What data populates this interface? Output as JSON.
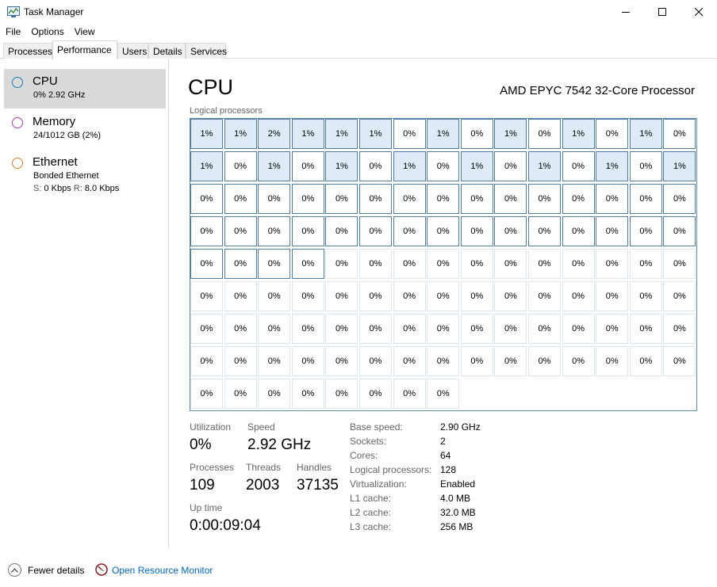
{
  "window": {
    "title": "Task Manager",
    "icon": "task-manager-icon"
  },
  "menu": [
    "File",
    "Options",
    "View"
  ],
  "tabs": [
    "Processes",
    "Performance",
    "Users",
    "Details",
    "Services"
  ],
  "active_tab": "Performance",
  "sidebar": {
    "items": [
      {
        "title": "CPU",
        "sub1": "0%  2.92 GHz",
        "color": "#1a7fbf",
        "selected": true
      },
      {
        "title": "Memory",
        "sub1": "24/1012 GB (2%)",
        "color": "#a040a8",
        "selected": false
      },
      {
        "title": "Ethernet",
        "sub1": "Bonded Ethernet",
        "sub2_s_label": "S:",
        "sub2_s_val": "0 Kbps",
        "sub2_r_label": "R:",
        "sub2_r_val": "8.0 Kbps",
        "color": "#d3812a",
        "selected": false
      }
    ]
  },
  "main": {
    "title": "CPU",
    "processor": "AMD EPYC 7542 32-Core Processor",
    "logical_label": "Logical processors",
    "cores": [
      "1%",
      "1%",
      "2%",
      "1%",
      "1%",
      "1%",
      "0%",
      "1%",
      "0%",
      "1%",
      "0%",
      "1%",
      "0%",
      "1%",
      "0%",
      "1%",
      "0%",
      "1%",
      "0%",
      "1%",
      "0%",
      "1%",
      "0%",
      "1%",
      "0%",
      "1%",
      "0%",
      "1%",
      "0%",
      "1%",
      "0%",
      "0%",
      "0%",
      "0%",
      "0%",
      "0%",
      "0%",
      "0%",
      "0%",
      "0%",
      "0%",
      "0%",
      "0%",
      "0%",
      "0%",
      "0%",
      "0%",
      "0%",
      "0%",
      "0%",
      "0%",
      "0%",
      "0%",
      "0%",
      "0%",
      "0%",
      "0%",
      "0%",
      "0%",
      "0%",
      "0%",
      "0%",
      "0%",
      "0%",
      "0%",
      "0%",
      "0%",
      "0%",
      "0%",
      "0%",
      "0%",
      "0%",
      "0%",
      "0%",
      "0%",
      "0%",
      "0%",
      "0%",
      "0%",
      "0%",
      "0%",
      "0%",
      "0%",
      "0%",
      "0%",
      "0%",
      "0%",
      "0%",
      "0%",
      "0%",
      "0%",
      "0%",
      "0%",
      "0%",
      "0%",
      "0%",
      "0%",
      "0%",
      "0%",
      "0%",
      "0%",
      "0%",
      "0%",
      "0%",
      "0%",
      "0%",
      "0%",
      "0%",
      "0%",
      "0%",
      "0%",
      "0%",
      "0%",
      "0%",
      "0%",
      "0%",
      "0%",
      "0%",
      "0%",
      "0%",
      "0%",
      "0%",
      "0%",
      "0%",
      "0%",
      "0%",
      "0%",
      "0%"
    ],
    "stats": {
      "utilization_label": "Utilization",
      "utilization": "0%",
      "speed_label": "Speed",
      "speed": "2.92 GHz",
      "processes_label": "Processes",
      "processes": "109",
      "threads_label": "Threads",
      "threads": "2003",
      "handles_label": "Handles",
      "handles": "37135",
      "uptime_label": "Up time",
      "uptime": "0:00:09:04"
    },
    "info": [
      {
        "label": "Base speed:",
        "value": "2.90 GHz"
      },
      {
        "label": "Sockets:",
        "value": "2"
      },
      {
        "label": "Cores:",
        "value": "64"
      },
      {
        "label": "Logical processors:",
        "value": "128"
      },
      {
        "label": "Virtualization:",
        "value": "Enabled"
      },
      {
        "label": "L1 cache:",
        "value": "4.0 MB"
      },
      {
        "label": "L2 cache:",
        "value": "32.0 MB"
      },
      {
        "label": "L3 cache:",
        "value": "256 MB"
      }
    ]
  },
  "footer": {
    "fewer_details": "Fewer details",
    "open_resource_monitor": "Open Resource Monitor"
  },
  "colors": {
    "grid_border": "#5d8cb8",
    "cell_fill_active": "#deebf7",
    "link": "#0066cc"
  }
}
